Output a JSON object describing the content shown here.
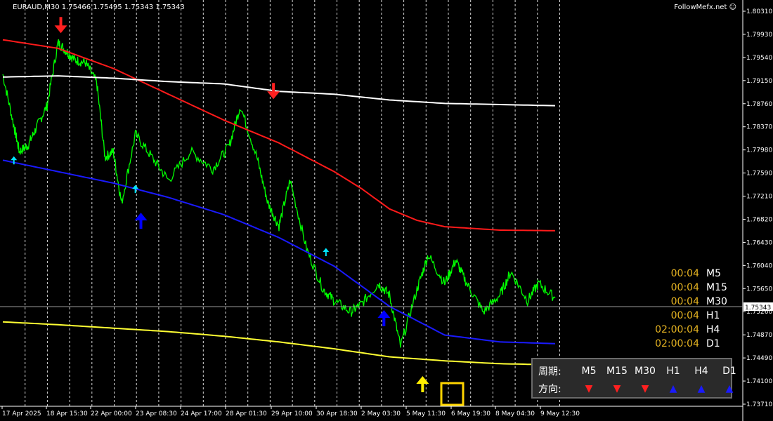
{
  "header": {
    "title": "EURAUD,M30 1.75466 1.75495 1.75343 1.75343"
  },
  "brand": {
    "label": "FollowMefx.net"
  },
  "current_price": {
    "label": "1.75343",
    "value": 1.75343
  },
  "timer": [
    {
      "value": "00:04",
      "tf": "M5"
    },
    {
      "value": "00:04",
      "tf": "M15"
    },
    {
      "value": "00:04",
      "tf": "M30"
    },
    {
      "value": "00:04",
      "tf": "H1"
    },
    {
      "value": "02:00:04",
      "tf": "H4"
    },
    {
      "value": "02:00:04",
      "tf": "D1"
    }
  ],
  "panel": {
    "period_label": "周期:",
    "direction_label": "方向:",
    "periods": [
      "M5",
      "M15",
      "M30",
      "H1",
      "H4",
      "D1"
    ],
    "directions": [
      "down",
      "down",
      "down",
      "up",
      "up",
      "up"
    ]
  },
  "colors": {
    "background": "#000000",
    "price": "#00ff00",
    "red_ma": "#ff1a1a",
    "white_ma": "#ffffff",
    "blue_ma": "#1a1aff",
    "yellow_ma": "#ffff33",
    "up_arrow": "#0000ff",
    "down_arrow": "#ff2020",
    "timer_value": "#e6b422",
    "panel_bg": "#2a2a2a",
    "grid": "#ffffff"
  },
  "chart_data": {
    "type": "line",
    "symbol": "EURAUD",
    "timeframe": "M30",
    "ylim": [
      1.7347,
      1.8047
    ],
    "y_ticks": [
      "1.80310",
      "1.79930",
      "1.79540",
      "1.79150",
      "1.78760",
      "1.78370",
      "1.77980",
      "1.77590",
      "1.77210",
      "1.76820",
      "1.76430",
      "1.76040",
      "1.75650",
      "1.75260",
      "1.74870",
      "1.74490",
      "1.74100",
      "1.73710"
    ],
    "x_ticks": [
      "17 Apr 2025",
      "18 Apr 15:30",
      "22 Apr 00:00",
      "23 Apr 08:30",
      "24 Apr 17:00",
      "28 Apr 01:30",
      "29 Apr 10:00",
      "30 Apr 18:30",
      "2 May 03:30",
      "5 May 11:30",
      "6 May 19:30",
      "8 May 04:30",
      "9 May 12:30"
    ],
    "series": [
      {
        "kind": "price",
        "x": [
          0,
          0.02,
          0.03,
          0.045,
          0.06,
          0.08,
          0.1,
          0.115,
          0.13,
          0.15,
          0.17,
          0.185,
          0.2,
          0.215,
          0.24,
          0.27,
          0.3,
          0.34,
          0.38,
          0.41,
          0.43,
          0.46,
          0.48,
          0.5,
          0.52,
          0.55,
          0.58,
          0.6,
          0.63,
          0.65,
          0.68,
          0.7,
          0.72,
          0.75,
          0.77,
          0.8,
          0.82,
          0.84,
          0.87,
          0.9,
          0.92,
          0.95,
          0.97,
          1.0
        ],
        "y": [
          1.7925,
          1.7835,
          1.779,
          1.78,
          1.783,
          1.787,
          1.798,
          1.7965,
          1.795,
          1.7945,
          1.791,
          1.778,
          1.779,
          1.77,
          1.782,
          1.778,
          1.774,
          1.779,
          1.776,
          1.78,
          1.787,
          1.778,
          1.77,
          1.766,
          1.774,
          1.762,
          1.755,
          1.753,
          1.751,
          1.7525,
          1.756,
          1.754,
          1.745,
          1.755,
          1.761,
          1.756,
          1.76,
          1.756,
          1.751,
          1.754,
          1.758,
          1.753,
          1.756,
          1.75343
        ]
      },
      {
        "kind": "red_ma",
        "x": [
          0,
          0.1,
          0.2,
          0.3,
          0.4,
          0.5,
          0.6,
          0.65,
          0.7,
          0.75,
          0.8,
          0.9,
          1.0
        ],
        "y": [
          1.7985,
          1.797,
          1.7935,
          1.789,
          1.7845,
          1.7805,
          1.7755,
          1.7725,
          1.769,
          1.767,
          1.7659,
          1.7653,
          1.7652
        ]
      },
      {
        "kind": "white_ma",
        "x": [
          0,
          0.1,
          0.2,
          0.3,
          0.4,
          0.5,
          0.6,
          0.7,
          0.8,
          0.9,
          1.0
        ],
        "y": [
          1.792,
          1.7922,
          1.7918,
          1.7912,
          1.7908,
          1.7895,
          1.789,
          1.788,
          1.7874,
          1.7872,
          1.787
        ]
      },
      {
        "kind": "blue_ma",
        "x": [
          0,
          0.1,
          0.2,
          0.3,
          0.4,
          0.5,
          0.6,
          0.7,
          0.8,
          0.9,
          1.0
        ],
        "y": [
          1.7775,
          1.7755,
          1.7735,
          1.771,
          1.768,
          1.764,
          1.759,
          1.752,
          1.747,
          1.7458,
          1.7455
        ]
      },
      {
        "kind": "yellow_ma",
        "x": [
          0,
          0.1,
          0.2,
          0.3,
          0.4,
          0.5,
          0.6,
          0.7,
          0.8,
          0.9,
          1.0
        ],
        "y": [
          1.7493,
          1.7488,
          1.7482,
          1.7476,
          1.7468,
          1.7458,
          1.7446,
          1.7432,
          1.7425,
          1.742,
          1.7418
        ]
      }
    ],
    "signals": [
      {
        "x": 0.02,
        "y": 1.7775,
        "dir": "up",
        "color": "cyan"
      },
      {
        "x": 0.105,
        "y": 1.801,
        "dir": "down",
        "color": "red"
      },
      {
        "x": 0.24,
        "y": 1.7725,
        "dir": "up",
        "color": "cyan"
      },
      {
        "x": 0.25,
        "y": 1.767,
        "dir": "up",
        "color": "blue"
      },
      {
        "x": 0.49,
        "y": 1.7895,
        "dir": "down",
        "color": "red"
      },
      {
        "x": 0.585,
        "y": 1.7615,
        "dir": "up",
        "color": "cyan"
      },
      {
        "x": 0.69,
        "y": 1.75,
        "dir": "up",
        "color": "blue"
      },
      {
        "x": 0.76,
        "y": 1.7385,
        "dir": "up",
        "color": "yellow"
      }
    ],
    "grid": true
  }
}
